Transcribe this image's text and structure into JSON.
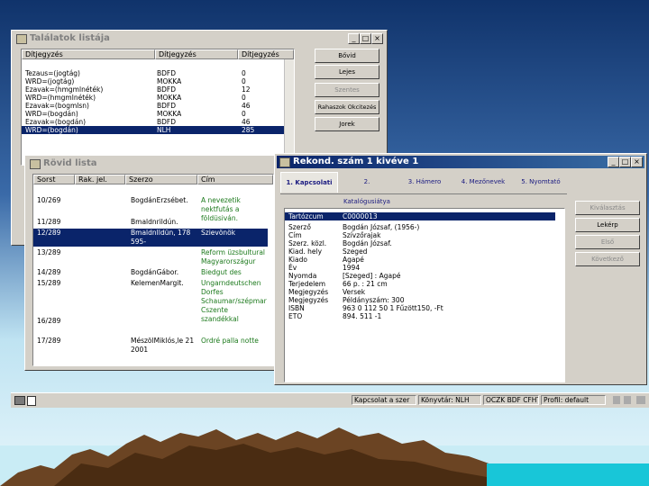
{
  "colors": {
    "selection": "#0a246a",
    "active_title": "#0a246a",
    "mountain": "#5a3a1e",
    "water": "#15c8d8"
  },
  "results_window": {
    "title": "Találatok listája",
    "columns": [
      "Dítjegyzés",
      "Dítjegyzés",
      "Dítjegyzés"
    ],
    "rows": [
      [
        "Tezaus=(jogtág)",
        "BDFD",
        "0"
      ],
      [
        "WRD=(jogtág)",
        "MOKKA",
        "0"
      ],
      [
        "Ezavak=(hmgmlnéték)",
        "BDFD",
        "12"
      ],
      [
        "WRD=(hmgmlnéték)",
        "MOKKA",
        "0"
      ],
      [
        "Ezavak=(bogmlsn)",
        "BDFD",
        "46"
      ],
      [
        "WRD=(bogdán)",
        "MOKKA",
        "0"
      ],
      [
        "Ezavak=(bogdán)",
        "BDFD",
        "46"
      ],
      [
        "WRD=(bogdán)",
        "NLH",
        "285"
      ]
    ],
    "buttons": {
      "b1": "Bővid",
      "b2": "Lejes",
      "b3": "Szentes",
      "b4": "Rahaszok Okcitezés",
      "b5": "Jorek"
    }
  },
  "short_window": {
    "title": "Rövid lista",
    "columns": [
      "Sorst",
      "Rak. jel.",
      "Szerzo",
      "Cím"
    ],
    "rows": [
      [
        "10/269",
        "",
        "BogdánErzsébet.",
        "A nevezetik nektfutás a földüsiván."
      ],
      [
        "11/289",
        "",
        "Bmaldnrildún.",
        ""
      ],
      [
        "12/289",
        "",
        "BmaldnIldün, 178 595-",
        "Szievönök"
      ],
      [
        "13/289",
        "",
        "",
        "Reform üzsbultural Magyarországur"
      ],
      [
        "14/289",
        "",
        "BogdánGábor.",
        "Biedgut des"
      ],
      [
        "15/289",
        "",
        "KelemenMargit.",
        "Ungarndeutschen Dorfes Schaumar/szépmar Cszente szandékkal"
      ],
      [
        "16/289",
        "",
        "",
        ""
      ],
      [
        "17/289",
        "",
        "MészölMiklós,le 21 2001",
        "Ordré palla notte"
      ]
    ]
  },
  "record_window": {
    "title": "Rekond. szám 1 kivéve 1",
    "tabs": [
      "1. Kapcsolati",
      "2. Katalógusiátya",
      "3. Hámero",
      "4. Mezőnevek",
      "5. Nyomtató"
    ],
    "fields": [
      [
        "Tartózcum",
        "C0000013"
      ],
      [
        "Szerző",
        "Bogdán Józsaf, (1956-)"
      ],
      [
        "Cím",
        "Szívzőrajak"
      ],
      [
        "Szerz. közl.",
        "Bogdán Józsaf."
      ],
      [
        "Kiad. hely",
        "Szeged"
      ],
      [
        "Kiado",
        "Agapé"
      ],
      [
        "Év",
        "1994"
      ],
      [
        "Nyomda",
        "[Szeged] : Agapé"
      ],
      [
        "Terjedelem",
        "66 p. : 21 cm"
      ],
      [
        "Megjegyzés",
        "Versek"
      ],
      [
        "Megjegyzés",
        "Példányszám: 300"
      ],
      [
        "ISBN",
        "963 0 112 50 1 Fűzött150, -Ft"
      ],
      [
        "ETO",
        "894. 511 -1"
      ]
    ],
    "buttons": {
      "b1": "Kiválasztás",
      "b2": "Lekérp",
      "b3": "Első",
      "b4": "Következő"
    }
  },
  "statusbar": {
    "left": "Kapcsolat a szer",
    "dir": "Könyvtár: NLH",
    "enc": "OCZK BDF CFHT",
    "profile": "Profil: default"
  }
}
